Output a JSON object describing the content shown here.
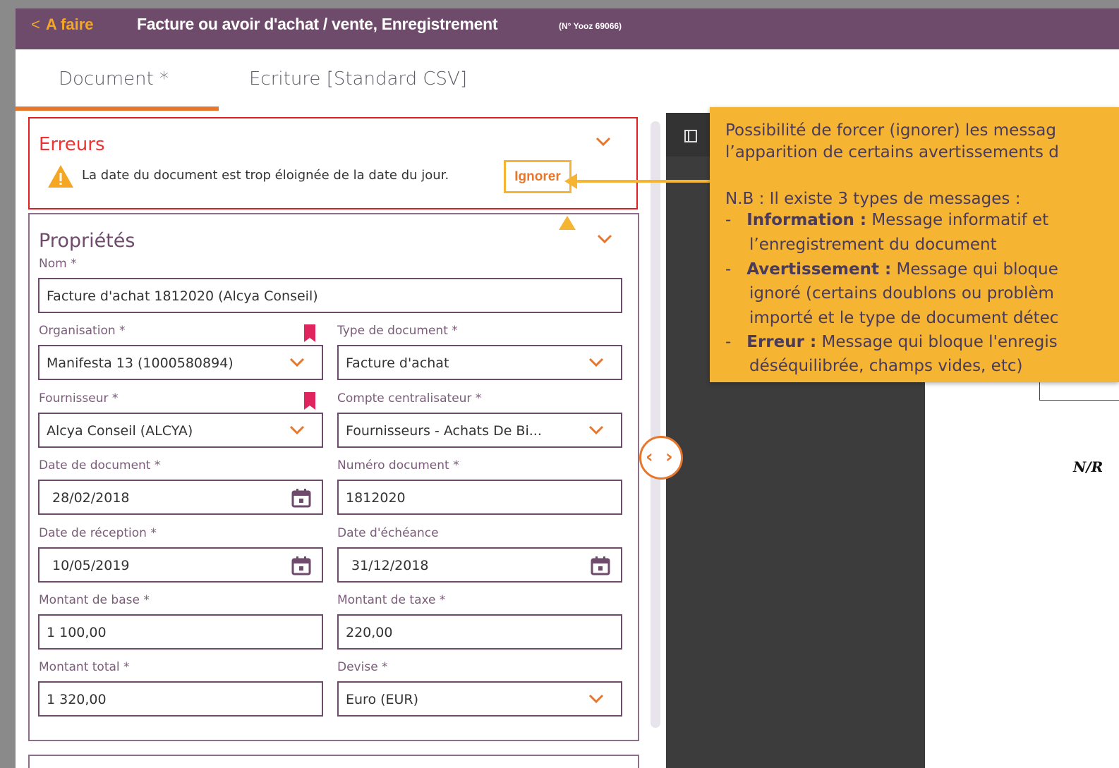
{
  "header": {
    "back_label": "A faire",
    "title": "Facture ou avoir d'achat / vente, Enregistrement",
    "yooz_ref": "(N° Yooz 69066)"
  },
  "tabs": [
    {
      "label": "Document *",
      "active": true
    },
    {
      "label": "Ecriture [Standard CSV]",
      "active": false
    }
  ],
  "errors": {
    "title": "Erreurs",
    "message": "La date du document est trop éloignée de la date du jour.",
    "ignore_label": "Ignorer"
  },
  "properties": {
    "title": "Propriétés",
    "nom": {
      "label": "Nom *",
      "value": "Facture d'achat 1812020 (Alcya Conseil)"
    },
    "organisation": {
      "label": "Organisation *",
      "value": "Manifesta 13 (1000580894)"
    },
    "type_document": {
      "label": "Type de document *",
      "value": "Facture d'achat"
    },
    "fournisseur": {
      "label": "Fournisseur *",
      "value": "Alcya Conseil (ALCYA)"
    },
    "compte": {
      "label": "Compte centralisateur *",
      "value": "Fournisseurs - Achats De Bi..."
    },
    "date_document": {
      "label": "Date de document *",
      "value": "28/02/2018"
    },
    "numero_document": {
      "label": "Numéro document *",
      "value": "1812020"
    },
    "date_reception": {
      "label": "Date de réception *",
      "value": "10/05/2019"
    },
    "date_echeance": {
      "label": "Date d'échéance",
      "value": "31/12/2018"
    },
    "montant_base": {
      "label": "Montant de base *",
      "value": "1 100,00"
    },
    "montant_taxe": {
      "label": "Montant de taxe *",
      "value": "220,00"
    },
    "montant_total": {
      "label": "Montant total *",
      "value": "1 320,00"
    },
    "devise": {
      "label": "Devise *",
      "value": "Euro (EUR)"
    }
  },
  "viewer": {
    "page_text": "N/R"
  },
  "callout": {
    "line1": "Possibilité de forcer (ignorer) les messag",
    "line2": "l’apparition de certains avertissements d",
    "line3": "N.B : Il existe 3 types de messages :",
    "info_term": "Information :",
    "info_text": " Message informatif et",
    "info_cont": "l’enregistrement du document",
    "warn_term": "Avertissement :",
    "warn_text": " Message qui bloque",
    "warn_cont1": "ignoré (certains doublons ou problèm",
    "warn_cont2": "importé et le type de document détec",
    "err_term": "Erreur :",
    "err_text": " Message qui bloque l'enregis",
    "err_cont": "déséquilibrée, champs vides, etc)",
    "dash": "-"
  },
  "colors": {
    "header_bg": "#6e4a6b",
    "accent": "#e8772e",
    "error": "#e02020",
    "callout": "#f5b533"
  }
}
